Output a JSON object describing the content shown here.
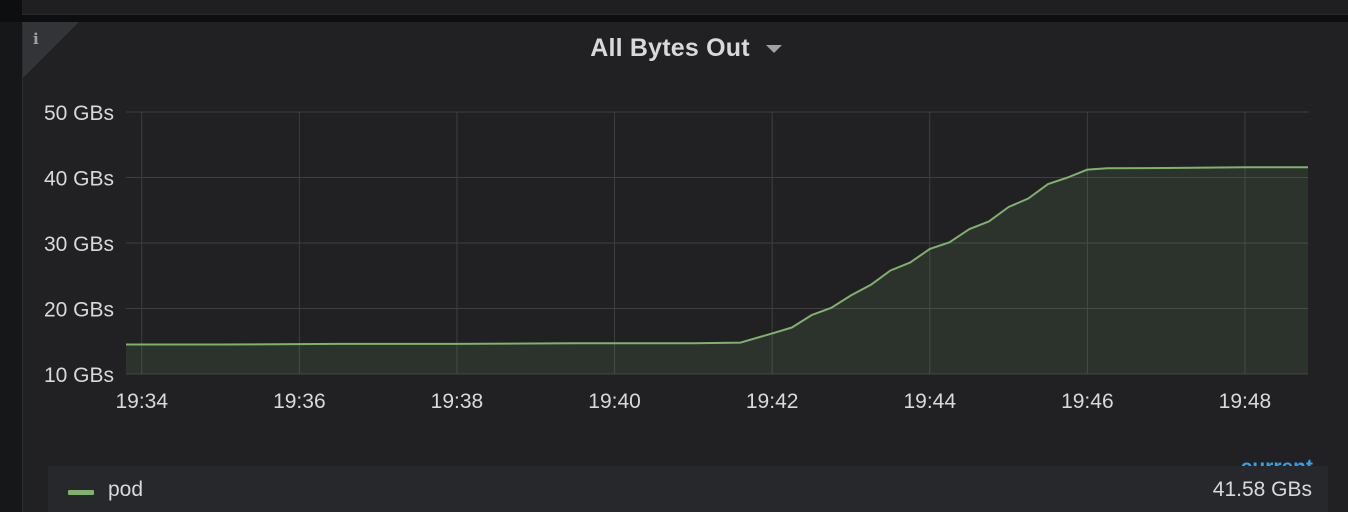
{
  "panel": {
    "title": "All Bytes Out",
    "info_icon": "i",
    "legend_header": "current",
    "legend": [
      {
        "name": "pod",
        "color": "#7eb26d",
        "current": "41.58 GBs"
      }
    ]
  },
  "chart_data": {
    "type": "area",
    "title": "All Bytes Out",
    "xlabel": "",
    "ylabel": "",
    "y_unit": "GBs",
    "ylim": [
      10,
      50
    ],
    "yticks": [
      10,
      20,
      30,
      40,
      50
    ],
    "ytick_labels": [
      "10 GBs",
      "20 GBs",
      "30 GBs",
      "40 GBs",
      "50 GBs"
    ],
    "xticks": [
      "19:34",
      "19:36",
      "19:38",
      "19:40",
      "19:42",
      "19:44",
      "19:46",
      "19:48"
    ],
    "xlim_minutes": [
      "19:33.8",
      "19:48.8"
    ],
    "grid": true,
    "series": [
      {
        "name": "pod",
        "color": "#7eb26d",
        "x": [
          "19:33.8",
          "19:35.0",
          "19:36.5",
          "19:38.0",
          "19:39.5",
          "19:41.0",
          "19:41.6",
          "19:42.0",
          "19:42.25",
          "19:42.5",
          "19:42.75",
          "19:43.0",
          "19:43.25",
          "19:43.5",
          "19:43.75",
          "19:44.0",
          "19:44.25",
          "19:44.5",
          "19:44.75",
          "19:45.0",
          "19:45.25",
          "19:45.5",
          "19:45.75",
          "19:46.0",
          "19:46.25",
          "19:47.0",
          "19:48.0",
          "19:48.8"
        ],
        "values": [
          14.5,
          14.5,
          14.6,
          14.6,
          14.7,
          14.7,
          14.8,
          16.2,
          17.1,
          19.0,
          20.1,
          22.0,
          23.6,
          25.8,
          27.0,
          29.1,
          30.1,
          32.1,
          33.3,
          35.5,
          36.8,
          39.0,
          40.0,
          41.2,
          41.4,
          41.45,
          41.55,
          41.58
        ]
      }
    ]
  }
}
